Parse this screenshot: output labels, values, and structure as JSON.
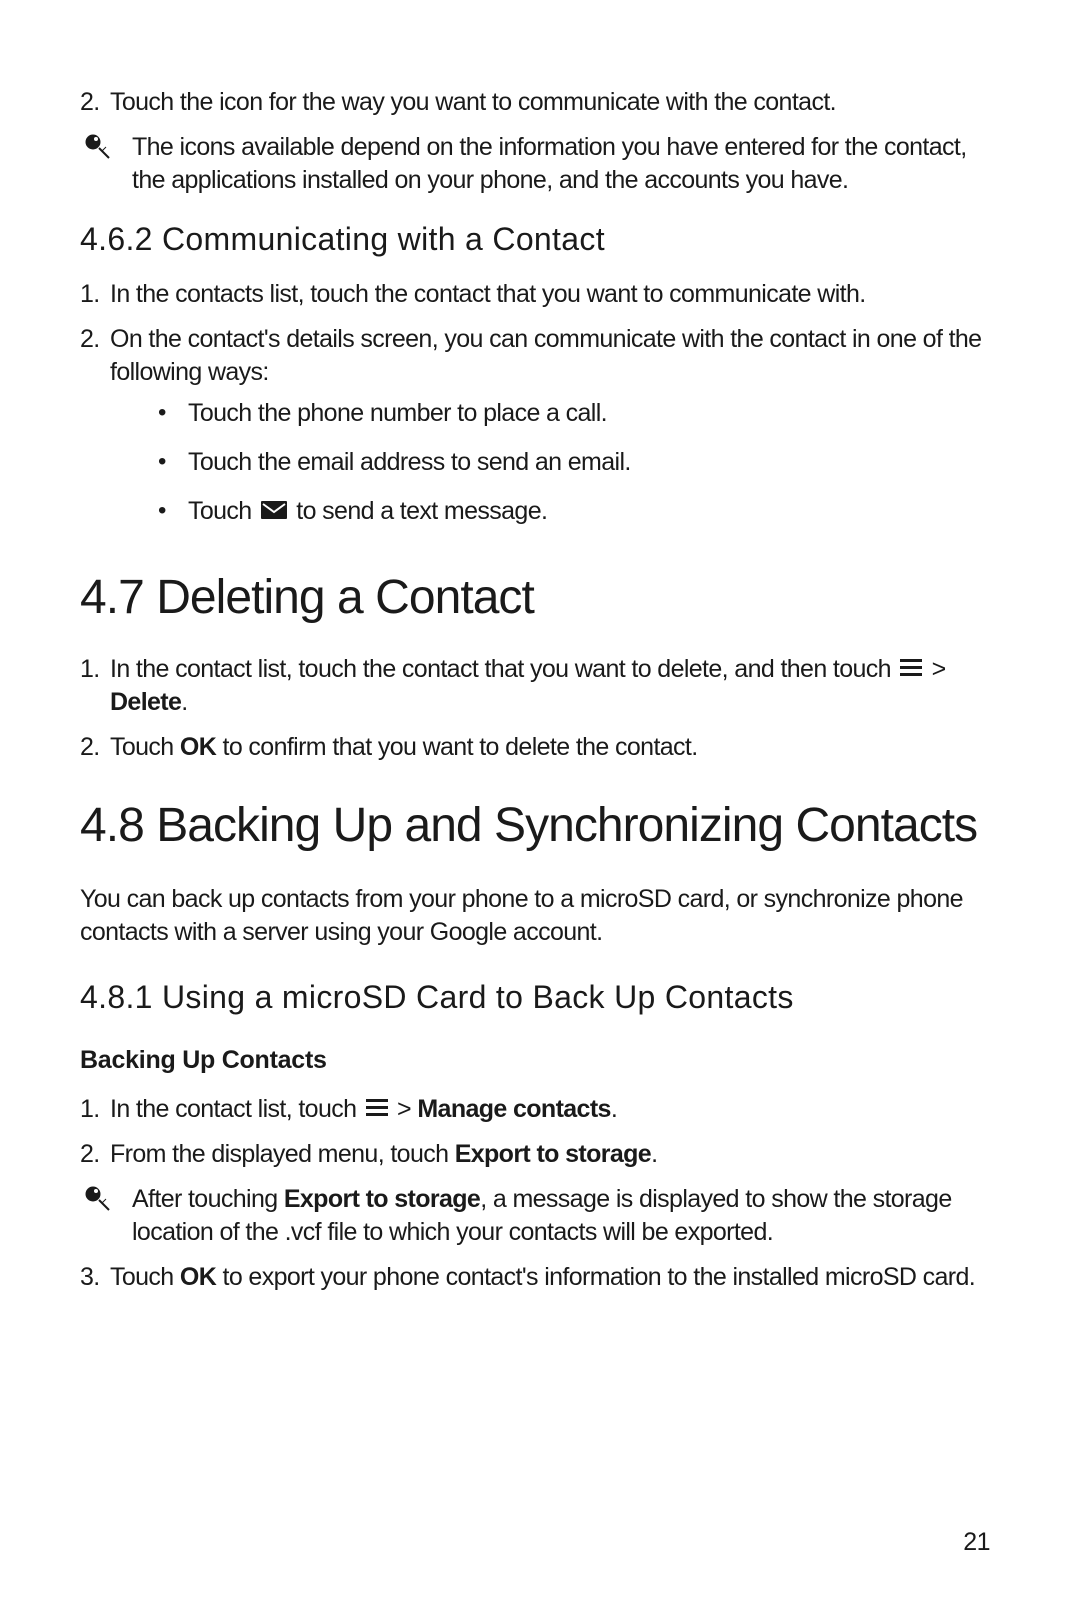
{
  "section_461_step2": "Touch the icon for the way you want to communicate with the contact.",
  "note1": "The icons available depend on the information you have entered for the contact, the applications installed on your phone, and the accounts you have.",
  "h462": "4.6.2  Communicating with a Contact",
  "step462_1": "In the contacts list, touch the contact that you want to communicate with.",
  "step462_2": "On the contact's details screen, you can communicate with the contact in one of the following ways:",
  "bullet462_1": "Touch the phone number to place a call.",
  "bullet462_2": "Touch the email address to send an email.",
  "bullet462_3a": "Touch ",
  "bullet462_3b": " to send a text message.",
  "h47": "4.7  Deleting a Contact",
  "step47_1a": "In the contact list, touch the contact that you want to delete, and then touch ",
  "step47_1b": " > ",
  "step47_1c": "Delete",
  "step47_1d": ".",
  "step47_2a": "Touch ",
  "step47_2b": "OK",
  "step47_2c": " to confirm that you want to delete the contact.",
  "h48": "4.8  Backing Up and Synchronizing Contacts",
  "p48_intro": "You can back up contacts from your phone to a microSD card, or synchronize phone contacts with a server using your Google account.",
  "h481": "4.8.1  Using a microSD Card to Back Up Contacts",
  "h481_sub": "Backing Up Contacts",
  "step481_1a": "In the contact list, touch ",
  "step481_1b": " > ",
  "step481_1c": "Manage contacts",
  "step481_1d": ".",
  "step481_2a": "From the displayed menu, touch ",
  "step481_2b": "Export to storage",
  "step481_2c": ".",
  "note481a": "After touching ",
  "note481b": "Export to storage",
  "note481c": ", a message is displayed to show the storage location of the .vcf file to which your contacts will be exported.",
  "step481_3a": "Touch ",
  "step481_3b": "OK",
  "step481_3c": " to export your phone contact's information to the installed microSD card.",
  "page_number": "21"
}
